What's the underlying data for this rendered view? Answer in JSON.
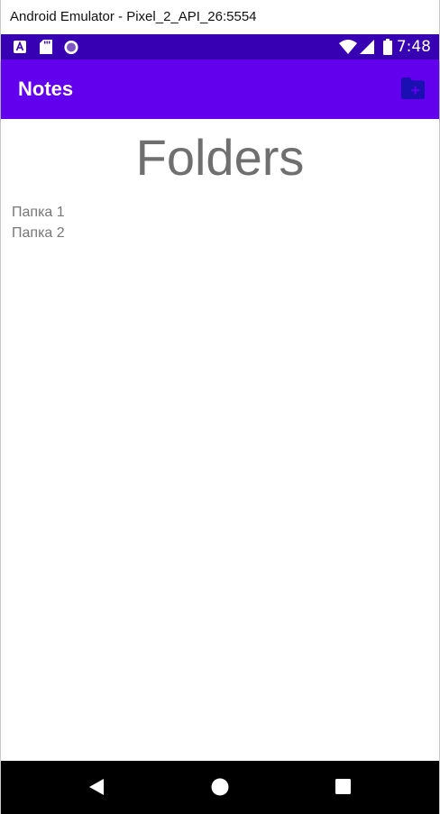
{
  "window": {
    "title": "Android Emulator - Pixel_2_API_26:5554"
  },
  "status_bar": {
    "time": "7:48",
    "left_icons": [
      "font-icon",
      "sd-card-icon",
      "circle-icon"
    ],
    "right_icons": [
      "wifi-icon",
      "signal-icon",
      "battery-icon"
    ],
    "color": "#3700b3"
  },
  "app_bar": {
    "title": "Notes",
    "action_icon": "create-new-folder-icon",
    "color": "#6200ee",
    "action_color": "#1a0fb0"
  },
  "main": {
    "heading": "Folders",
    "folders": [
      "Папка 1",
      "Папка 2"
    ]
  },
  "nav_bar": {
    "buttons": [
      "back-icon",
      "home-icon",
      "recents-icon"
    ]
  }
}
